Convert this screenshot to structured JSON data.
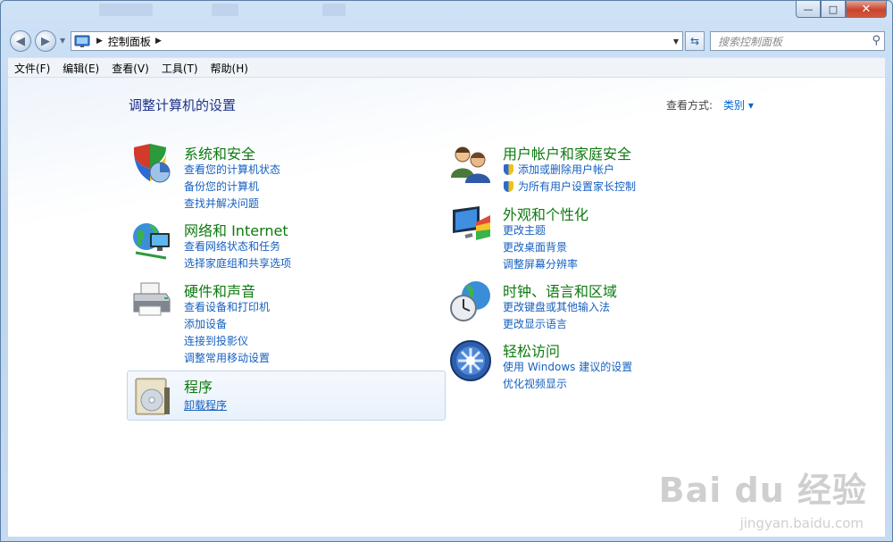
{
  "window": {
    "caption_buttons": [
      "—",
      "□",
      "✕"
    ]
  },
  "nav": {
    "breadcrumb": "控制面板",
    "search_placeholder": "搜索控制面板"
  },
  "menu": [
    "文件(F)",
    "编辑(E)",
    "查看(V)",
    "工具(T)",
    "帮助(H)"
  ],
  "main": {
    "heading": "调整计算机的设置",
    "view_by_label": "查看方式:",
    "view_by_value": "类别 ▾"
  },
  "categories": [
    {
      "title": "系统和安全",
      "icon": "shield-icon",
      "links": [
        "查看您的计算机状态",
        "备份您的计算机",
        "查找并解决问题"
      ]
    },
    {
      "title": "网络和 Internet",
      "icon": "network-icon",
      "links": [
        "查看网络状态和任务",
        "选择家庭组和共享选项"
      ]
    },
    {
      "title": "硬件和声音",
      "icon": "printer-icon",
      "links": [
        "查看设备和打印机",
        "添加设备",
        "连接到投影仪",
        "调整常用移动设置"
      ]
    },
    {
      "title": "程序",
      "icon": "programs-icon",
      "links": [
        "卸载程序"
      ]
    },
    {
      "title": "用户帐户和家庭安全",
      "icon": "users-icon",
      "links": [
        "添加或删除用户帐户",
        "为所有用户设置家长控制"
      ]
    },
    {
      "title": "外观和个性化",
      "icon": "display-icon",
      "links": [
        "更改主题",
        "更改桌面背景",
        "调整屏幕分辨率"
      ]
    },
    {
      "title": "时钟、语言和区域",
      "icon": "clock-globe-icon",
      "links": [
        "更改键盘或其他输入法",
        "更改显示语言"
      ]
    },
    {
      "title": "轻松访问",
      "icon": "ease-of-access-icon",
      "links": [
        "使用 Windows 建议的设置",
        "优化视频显示"
      ]
    }
  ],
  "watermark": {
    "main": "Bai du 经验",
    "sub": "jingyan.baidu.com"
  }
}
